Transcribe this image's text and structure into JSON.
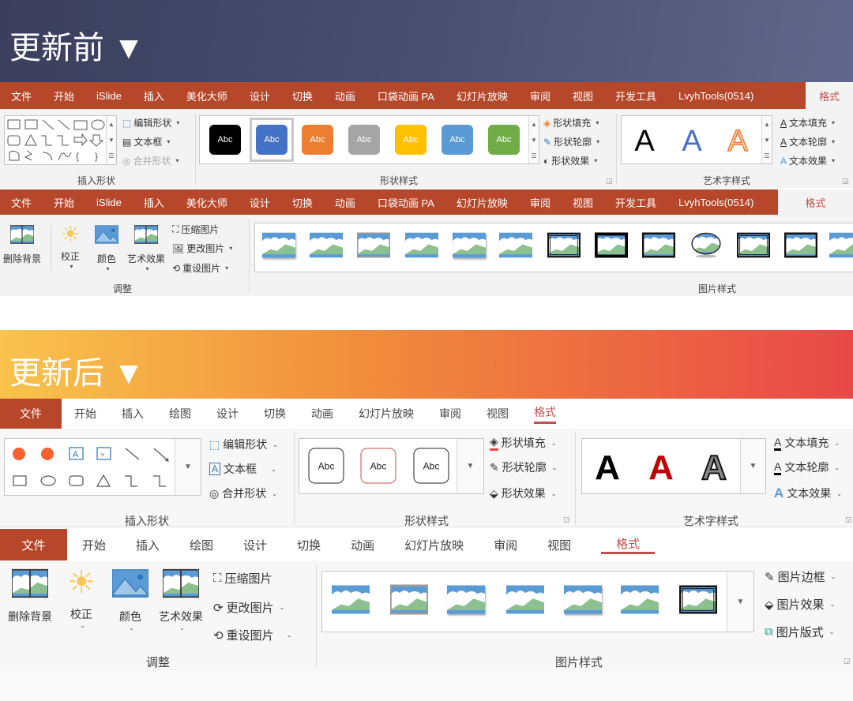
{
  "before": {
    "title": "更新前 ▼",
    "ribbon_shape": {
      "tabs": [
        "文件",
        "开始",
        "iSlide",
        "插入",
        "美化大师",
        "设计",
        "切换",
        "动画",
        "口袋动画 PA",
        "幻灯片放映",
        "审阅",
        "视图",
        "开发工具",
        "LvyhTools(0514)"
      ],
      "active_tab": "格式",
      "groups": {
        "insert_shapes": {
          "label": "插入形状",
          "edit_shape": "编辑形状",
          "text_box": "文本框",
          "merge_shapes": "合并形状"
        },
        "shape_styles": {
          "label": "形状样式",
          "swatch_text": "Abc",
          "swatch_colors": [
            "#000000",
            "#4472c4",
            "#ed7d31",
            "#a5a5a5",
            "#ffc000",
            "#5b9bd5",
            "#70ad47"
          ],
          "selected_index": 1,
          "fill": "形状填充",
          "outline": "形状轮廓",
          "effects": "形状效果"
        },
        "wordart_styles": {
          "label": "艺术字样式",
          "letter": "A",
          "text_fill": "文本填充",
          "text_outline": "文本轮廓",
          "text_effects": "文本效果"
        }
      }
    },
    "ribbon_picture": {
      "tabs": [
        "文件",
        "开始",
        "iSlide",
        "插入",
        "美化大师",
        "设计",
        "切换",
        "动画",
        "口袋动画 PA",
        "幻灯片放映",
        "审阅",
        "视图",
        "开发工具",
        "LvyhTools(0514)"
      ],
      "active_tab": "格式",
      "groups": {
        "adjust": {
          "label": "调整",
          "remove_bg": "删除背景",
          "corrections": "校正",
          "color": "颜色",
          "artistic": "艺术效果",
          "compress": "压缩图片",
          "change": "更改图片",
          "reset": "重设图片"
        },
        "picture_styles": {
          "label": "图片样式"
        }
      }
    }
  },
  "after": {
    "title": "更新后 ▼",
    "ribbon_shape": {
      "file_tab": "文件",
      "tabs": [
        "开始",
        "插入",
        "绘图",
        "设计",
        "切换",
        "动画",
        "幻灯片放映",
        "审阅",
        "视图"
      ],
      "active_tab": "格式",
      "groups": {
        "insert_shapes": {
          "label": "插入形状",
          "edit_shape": "编辑形状",
          "text_box": "文本框",
          "merge_shapes": "合并形状"
        },
        "shape_styles": {
          "label": "形状样式",
          "swatch_text": "Abc",
          "fill": "形状填充",
          "outline": "形状轮廓",
          "effects": "形状效果"
        },
        "wordart_styles": {
          "label": "艺术字样式",
          "letter": "A",
          "text_fill": "文本填充",
          "text_outline": "文本轮廓",
          "text_effects": "文本效果"
        }
      }
    },
    "ribbon_picture": {
      "file_tab": "文件",
      "tabs": [
        "开始",
        "插入",
        "绘图",
        "设计",
        "切换",
        "动画",
        "幻灯片放映",
        "审阅",
        "视图"
      ],
      "active_tab": "格式",
      "groups": {
        "adjust": {
          "label": "调整",
          "remove_bg": "删除背景",
          "corrections": "校正",
          "color": "颜色",
          "artistic": "艺术效果",
          "compress": "压缩图片",
          "change": "更改图片",
          "reset": "重设图片"
        },
        "picture_styles": {
          "label": "图片样式",
          "border": "图片边框",
          "effects": "图片效果",
          "layout": "图片版式"
        }
      }
    }
  },
  "colors": {
    "tab_red": "#b7472a",
    "active_red": "#c0504d",
    "shape_orange": "#f4622d"
  }
}
